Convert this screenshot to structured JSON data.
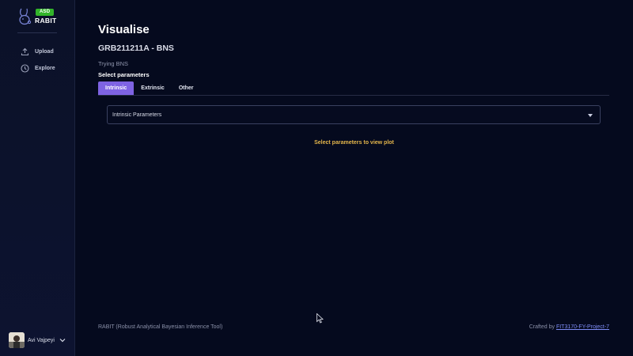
{
  "sidebar": {
    "brand": {
      "badge": "ASD",
      "name": "RABIT"
    },
    "nav": [
      {
        "label": "Upload",
        "icon": "upload-icon"
      },
      {
        "label": "Explore",
        "icon": "clock-icon"
      }
    ],
    "user": {
      "name": "Avi Vajpeyi",
      "icon": "chevron-down-icon"
    }
  },
  "main": {
    "title": "Visualise",
    "run_title": "GRB211211A - BNS",
    "run_description": "Trying BNS",
    "select_label": "Select parameters",
    "tabs": [
      {
        "label": "Intrinsic",
        "active": true
      },
      {
        "label": "Extrinsic",
        "active": false
      },
      {
        "label": "Other",
        "active": false
      }
    ],
    "select": {
      "value": "Intrinsic Parameters"
    },
    "plot_message": "Select parameters to view plot"
  },
  "footer": {
    "left": "RABIT (Robust Analytical Bayesian Inference Tool)",
    "right_prefix": "Crafted by",
    "right_link": "FIT3170-FY-Project-7"
  },
  "colors": {
    "background": "#050a1e",
    "sidebar": "#0b1128",
    "accent": "#7e63e3",
    "badge": "#33b52a",
    "warning_text": "#e3b54b",
    "link": "#7e8cf5"
  }
}
